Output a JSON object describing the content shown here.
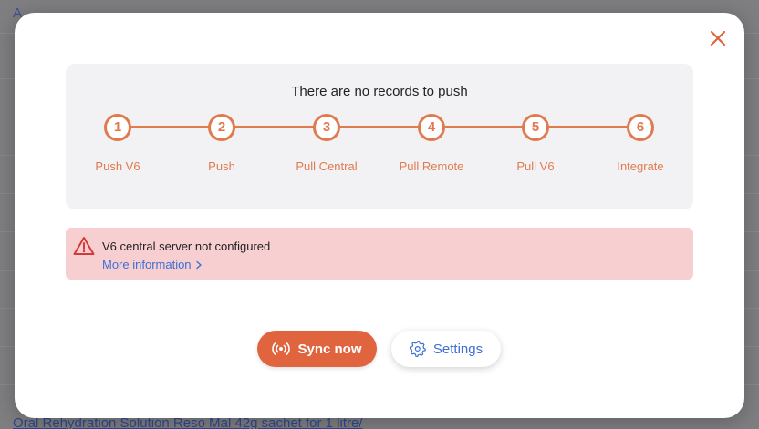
{
  "background": {
    "top_text": "A",
    "bottom_text": "Oral Rehydration Solution Reso Mal 42g sachet for 1 litre/"
  },
  "modal": {
    "status_message": "There are no records to push",
    "steps": [
      {
        "number": "1",
        "label": "Push V6"
      },
      {
        "number": "2",
        "label": "Push"
      },
      {
        "number": "3",
        "label": "Pull Central"
      },
      {
        "number": "4",
        "label": "Pull Remote"
      },
      {
        "number": "5",
        "label": "Pull V6"
      },
      {
        "number": "6",
        "label": "Integrate"
      }
    ],
    "alert": {
      "title": "V6 central server not configured",
      "link_label": "More information"
    },
    "actions": {
      "sync_label": "Sync now",
      "settings_label": "Settings"
    }
  },
  "icons": {
    "close": "close-icon",
    "alert": "warning-triangle-icon",
    "link": "chevron-right-icon",
    "sync": "radio-waves-icon",
    "settings": "gear-icon"
  },
  "colors": {
    "accent": "#e0643e",
    "step": "#e07a4f",
    "link": "#3d6fd6",
    "alert_bg": "#f7cfd0",
    "alert_icon": "#d33b3b"
  }
}
